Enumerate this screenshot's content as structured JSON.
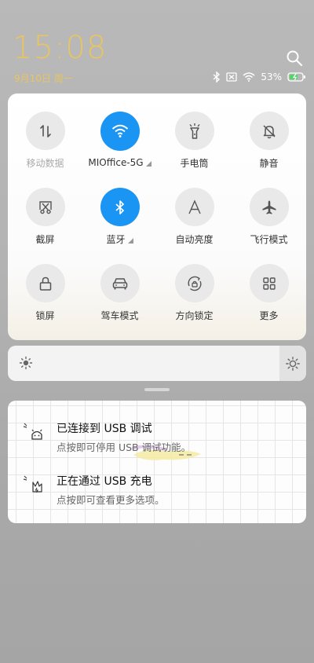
{
  "status": {
    "time": "15:08",
    "date": "9月10日 周一",
    "battery": "53%"
  },
  "tiles": [
    {
      "name": "mobile-data",
      "label": "移动数据",
      "on": false,
      "dim": true,
      "icon": "swap-arrows-icon"
    },
    {
      "name": "wifi",
      "label": "MIOffice-5G",
      "on": true,
      "caret": true,
      "icon": "wifi-icon"
    },
    {
      "name": "flashlight",
      "label": "手电筒",
      "on": false,
      "icon": "flashlight-icon"
    },
    {
      "name": "silent",
      "label": "静音",
      "on": false,
      "icon": "bell-off-icon"
    },
    {
      "name": "screenshot",
      "label": "截屏",
      "on": false,
      "icon": "scissors-icon"
    },
    {
      "name": "bluetooth",
      "label": "蓝牙",
      "on": true,
      "caret": true,
      "icon": "bluetooth-icon"
    },
    {
      "name": "auto-brightness",
      "label": "自动亮度",
      "on": false,
      "icon": "letter-a-icon"
    },
    {
      "name": "airplane-mode",
      "label": "飞行模式",
      "on": false,
      "icon": "airplane-icon"
    },
    {
      "name": "lock-screen",
      "label": "锁屏",
      "on": false,
      "icon": "lock-icon"
    },
    {
      "name": "driving-mode",
      "label": "驾车模式",
      "on": false,
      "icon": "car-icon"
    },
    {
      "name": "rotation-lock",
      "label": "方向锁定",
      "on": false,
      "icon": "rotation-lock-icon"
    },
    {
      "name": "more",
      "label": "更多",
      "on": false,
      "icon": "grid-icon"
    }
  ],
  "notifications": [
    {
      "title": "已连接到  USB  调试",
      "subtitle": "点按即可停用 USB 调试功能。",
      "icon": "android-debug-icon"
    },
    {
      "title": "正在通过  USB  充电",
      "subtitle": "点按即可查看更多选项。",
      "icon": "charging-icon"
    }
  ],
  "colors": {
    "accent": "#1b95f4",
    "clock": "#e7c560"
  }
}
